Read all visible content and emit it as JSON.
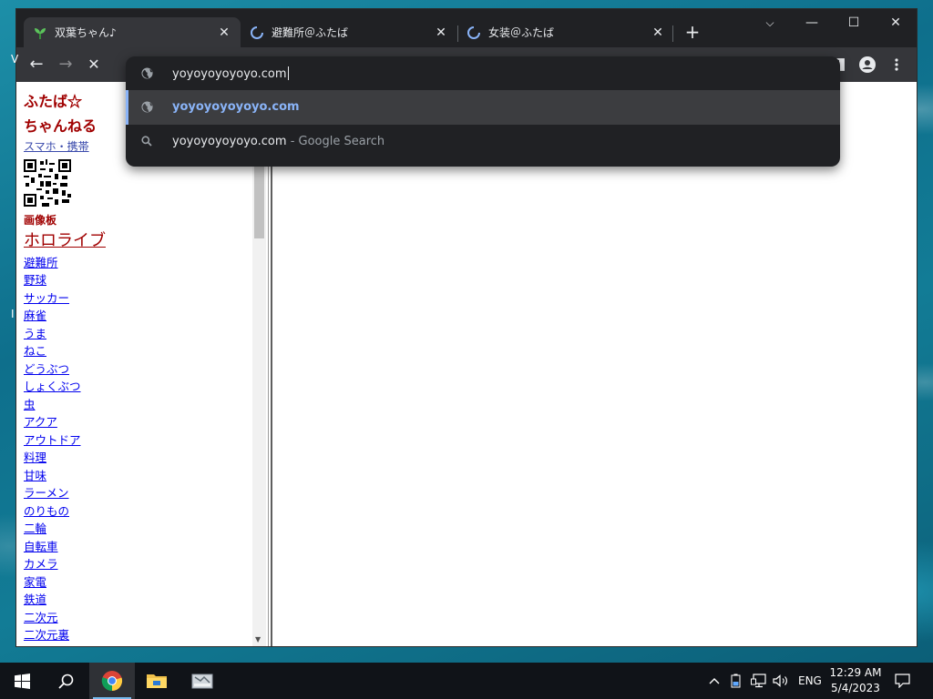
{
  "browser": {
    "tabs": [
      {
        "title": "双葉ちゃん♪",
        "active": true,
        "loading": false
      },
      {
        "title": "避難所＠ふたば",
        "active": false,
        "loading": true
      },
      {
        "title": "女装＠ふたば",
        "active": false,
        "loading": true
      }
    ],
    "tab_close_glyph": "✕",
    "new_tab_glyph": "+",
    "window_controls": {
      "tab_search": "⌵",
      "minimize": "—",
      "maximize": "☐",
      "close": "✕"
    },
    "toolbar": {
      "back": "←",
      "forward": "→",
      "stop": "✕"
    }
  },
  "omnibox": {
    "input_value": "yoyoyoyoyoyo.com",
    "suggestions": [
      {
        "text": "yoyoyoyoyoyo.com",
        "suffix": "",
        "icon": "globe-icon",
        "selected": true
      },
      {
        "text": "yoyoyoyoyoyo.com",
        "suffix": " - Google Search",
        "icon": "search-icon",
        "selected": false
      }
    ]
  },
  "sidebar": {
    "logo_line1": "ふたば☆",
    "logo_line2": "ちゃんねる",
    "mobile_link": "スマホ・携帯",
    "section_title": "画像板",
    "featured_link": "ホロライブ",
    "links": [
      "避難所",
      "野球",
      "サッカー",
      "麻雀",
      "うま",
      "ねこ",
      "どうぶつ",
      "しょくぶつ",
      "虫",
      "アクア",
      "アウトドア",
      "料理",
      "甘味",
      "ラーメン",
      "のりもの",
      "二輪",
      "自転車",
      "カメラ",
      "家電",
      "鉄道",
      "二次元",
      "二次元裏"
    ]
  },
  "taskbar": {
    "language": "ENG",
    "time": "12:29 AM",
    "date": "5/4/2023"
  },
  "colors": {
    "accent_link": "#8ab4f8",
    "logo_red": "#a00000",
    "tab_bg": "#35363a",
    "titlebar_bg": "#202124"
  }
}
